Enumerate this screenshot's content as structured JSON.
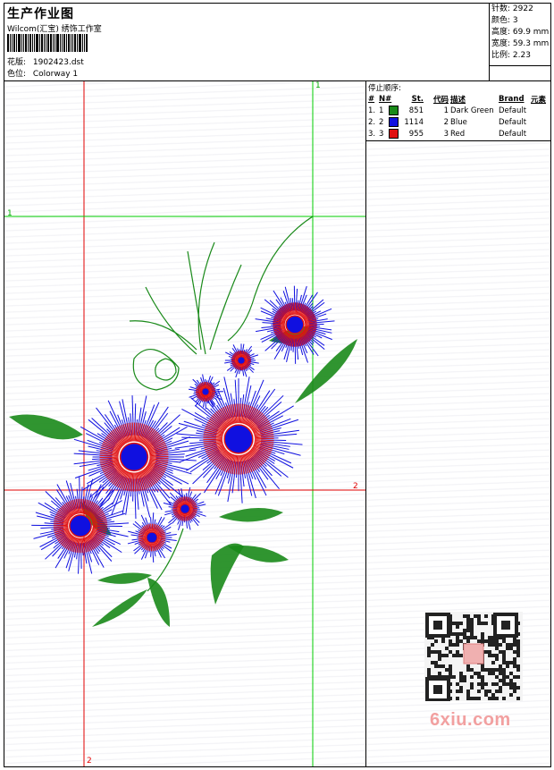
{
  "header": {
    "title": "生产作业图",
    "subtitle": "Wilcom(汇宝) 绣饰工作室",
    "file_label": "花版:",
    "file_value": "1902423.dst",
    "colorway_label": "色位:",
    "colorway_value": "Colorway 1"
  },
  "stats": {
    "stitches": "针数: 2922",
    "colors": "颜色: 3",
    "height": "高度: 69.9 mm",
    "width": "宽度: 59.3 mm",
    "ratio": "比例: 2.23"
  },
  "stop_sequence": {
    "title": "停止顺序:",
    "headers": [
      "#",
      "N#",
      "St.",
      "代码",
      "描述",
      "Brand",
      "元素"
    ],
    "rows": [
      {
        "num": "1.",
        "n": "1",
        "color": "#1a8a1a",
        "st": "851",
        "code": "1",
        "desc": "Dark Green",
        "brand": "Default"
      },
      {
        "num": "2.",
        "n": "2",
        "color": "#1010e0",
        "st": "1114",
        "code": "2",
        "desc": "Blue",
        "brand": "Default"
      },
      {
        "num": "3.",
        "n": "3",
        "color": "#e01010",
        "st": "955",
        "code": "3",
        "desc": "Red",
        "brand": "Default"
      }
    ]
  },
  "guides": {
    "v1": "1",
    "h1": "1",
    "h2": "2",
    "v2": "2"
  },
  "colors": {
    "green": "#1a8a1a",
    "blue": "#1010e0",
    "red": "#e01010",
    "guide_red": "#e00000",
    "guide_green": "#00cc00"
  },
  "watermark": "6xiu.com"
}
